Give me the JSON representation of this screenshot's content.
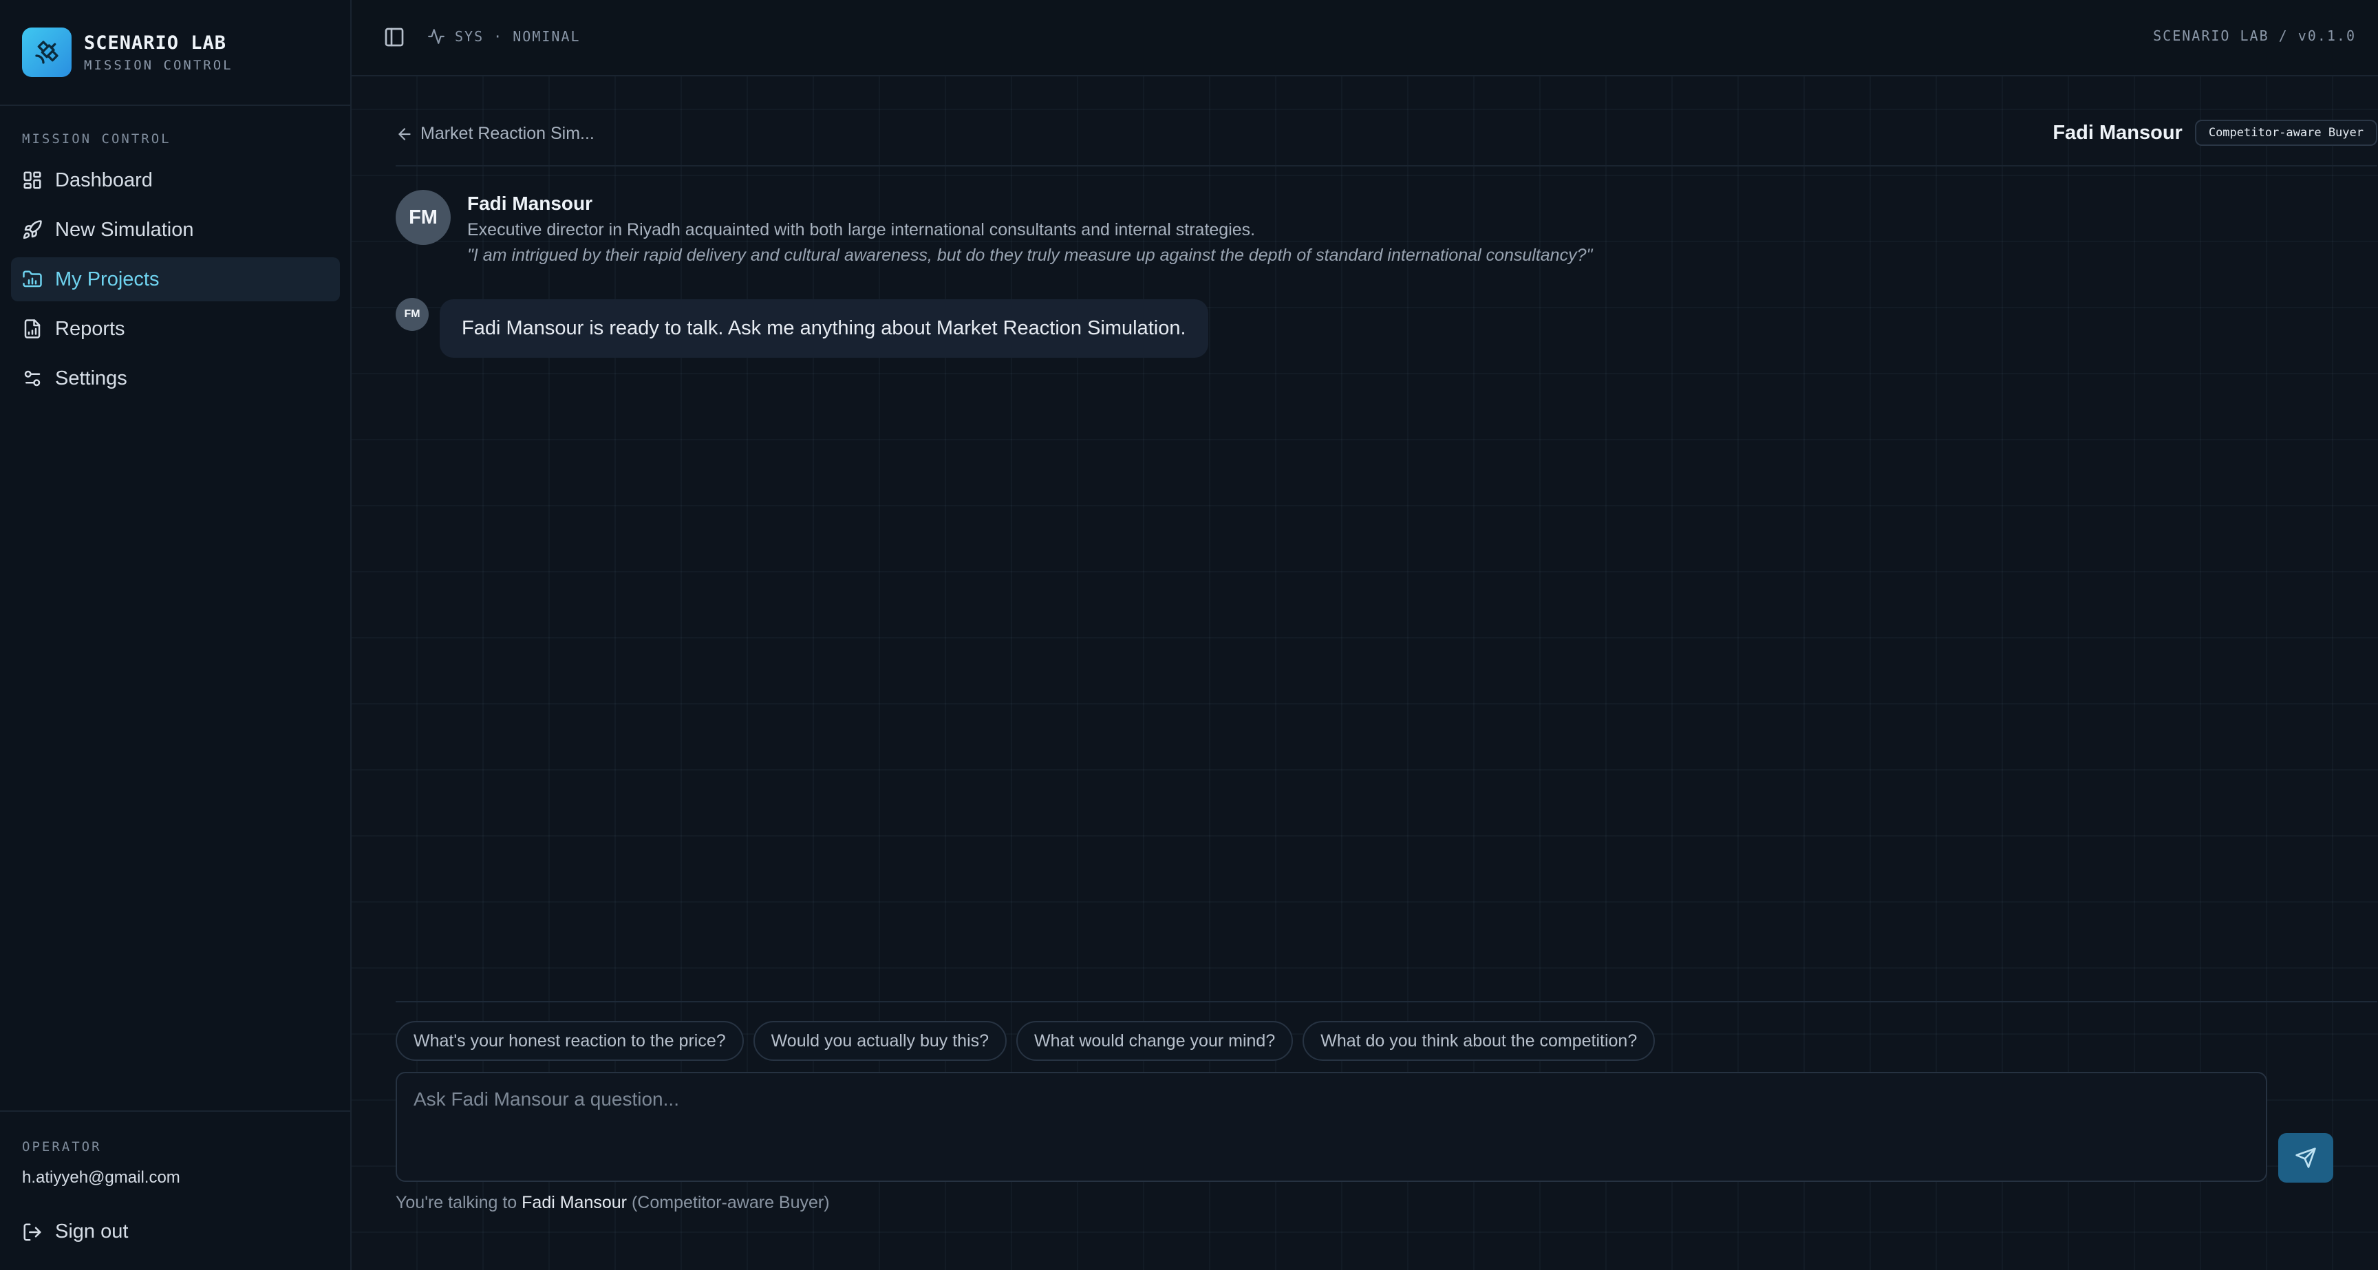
{
  "brand": {
    "name": "SCENARIO LAB",
    "subtitle": "MISSION CONTROL"
  },
  "sidebar": {
    "section_heading": "MISSION CONTROL",
    "items": [
      {
        "label": "Dashboard",
        "icon": "dashboard-icon"
      },
      {
        "label": "New Simulation",
        "icon": "rocket-icon"
      },
      {
        "label": "My Projects",
        "icon": "projects-icon",
        "active": true
      },
      {
        "label": "Reports",
        "icon": "report-icon"
      },
      {
        "label": "Settings",
        "icon": "sliders-icon"
      }
    ],
    "operator_label": "OPERATOR",
    "operator_email": "h.atiyyeh@gmail.com",
    "signout_label": "Sign out"
  },
  "topbar": {
    "status": "SYS · NOMINAL",
    "version": "SCENARIO LAB / v0.1.0"
  },
  "chat": {
    "back_label": "Market Reaction Sim...",
    "persona_name": "Fadi Mansour",
    "persona_tag": "Competitor-aware Buyer",
    "profile": {
      "initials": "FM",
      "name": "Fadi Mansour",
      "description": "Executive director in Riyadh acquainted with both large international consultants and internal strategies.",
      "quote": "\"I am intrigued by their rapid delivery and cultural awareness, but do they truly measure up against the depth of standard international consultancy?\""
    },
    "messages": [
      {
        "initials": "FM",
        "text": "Fadi Mansour is ready to talk. Ask me anything about Market Reaction Simulation."
      }
    ],
    "suggestions": [
      "What's your honest reaction to the price?",
      "Would you actually buy this?",
      "What would change your mind?",
      "What do you think about the competition?"
    ],
    "input_placeholder": "Ask Fadi Mansour a question...",
    "footnote_prefix": "You're talking to ",
    "footnote_name": "Fadi Mansour",
    "footnote_role": " (Competitor-aware Buyer)"
  },
  "colors": {
    "accent": "#6fd3ef",
    "background": "#0b111a",
    "send_button": "#1d5f86"
  }
}
